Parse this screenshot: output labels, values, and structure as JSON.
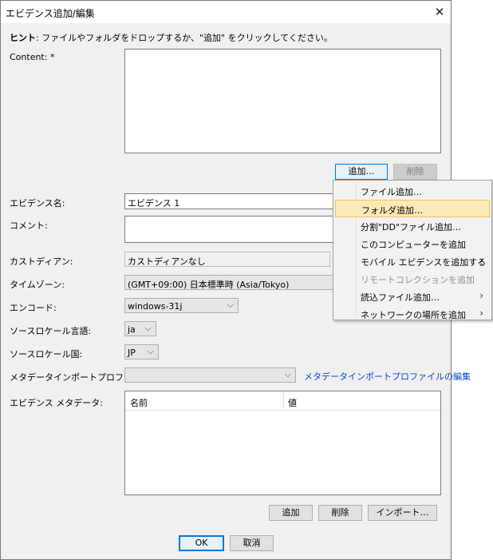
{
  "window": {
    "title": "エビデンス追加/編集",
    "close_glyph": "✕"
  },
  "hint": {
    "bold": "ヒント",
    "text": ": ファイルやフォルダをドロップするか、\"追加\" をクリックしてください。"
  },
  "content": {
    "label": "Content: *",
    "add_button": "追加…",
    "delete_button": "削除"
  },
  "evidence_name": {
    "label": "エビデンス名:",
    "value": "エビデンス 1"
  },
  "comment": {
    "label": "コメント:",
    "value": ""
  },
  "custodian": {
    "label": "カストディアン:",
    "value": "カストディアンなし"
  },
  "timezone": {
    "label": "タイムゾーン:",
    "value": "(GMT+09:00) 日本標準時 (Asia/Tokyo)"
  },
  "encoding": {
    "label": "エンコード:",
    "value": "windows-31j"
  },
  "locale_language": {
    "label": "ソースロケール言語:",
    "value": "ja"
  },
  "locale_country": {
    "label": "ソースロケール国:",
    "value": "JP"
  },
  "metadata_import": {
    "label": "メタデータインポートプロファイル",
    "value": "",
    "edit_link": "メタデータインポートプロファイルの編集"
  },
  "evidence_metadata": {
    "label": "エビデンス メタデータ:",
    "columns": [
      "名前",
      "値"
    ],
    "add_button": "追加",
    "delete_button": "削除",
    "import_button": "インポート…"
  },
  "footer": {
    "ok": "OK",
    "cancel": "取消"
  },
  "add_menu": {
    "items": [
      {
        "label": "ファイル追加…",
        "state": "normal",
        "submenu": false
      },
      {
        "label": "フォルダ追加…",
        "state": "highlighted",
        "submenu": false
      },
      {
        "label": "分割\"DD\"ファイル追加…",
        "state": "normal",
        "submenu": false
      },
      {
        "label": "このコンピューターを追加",
        "state": "normal",
        "submenu": false
      },
      {
        "label": "モバイル エビデンスを追加する",
        "state": "normal",
        "submenu": true
      },
      {
        "label": "リモートコレクションを追加",
        "state": "disabled",
        "submenu": false
      },
      {
        "label": "読込ファイル追加…",
        "state": "normal",
        "submenu": true
      },
      {
        "label": "ネットワークの場所を追加",
        "state": "normal",
        "submenu": true
      }
    ],
    "submenu_glyph": "›"
  },
  "colors": {
    "accent": "#0078d7",
    "menu_highlight": "#fce9b8",
    "link": "#0046d5"
  }
}
